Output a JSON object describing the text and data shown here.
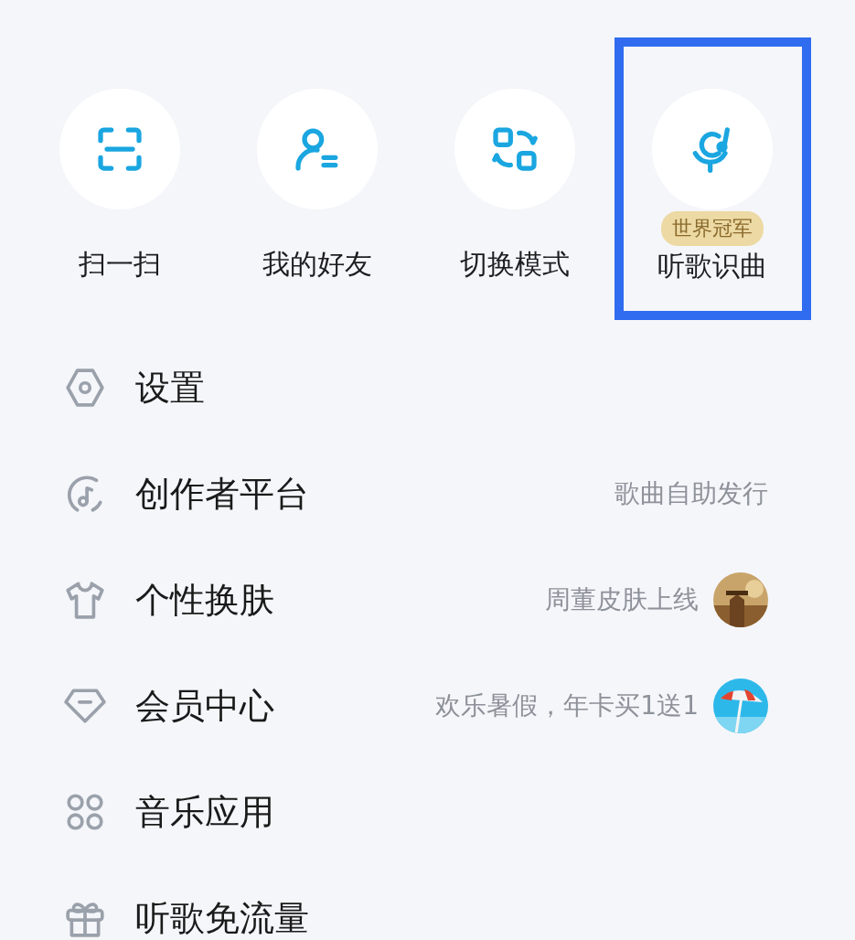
{
  "shortcuts": [
    {
      "label": "扫一扫",
      "highlighted": false
    },
    {
      "label": "我的好友",
      "highlighted": false
    },
    {
      "label": "切换模式",
      "highlighted": false
    },
    {
      "label": "听歌识曲",
      "badge": "世界冠军",
      "highlighted": true
    }
  ],
  "menu": [
    {
      "label": "设置"
    },
    {
      "label": "创作者平台",
      "note": "歌曲自助发行"
    },
    {
      "label": "个性换肤",
      "note": "周董皮肤上线"
    },
    {
      "label": "会员中心",
      "note": "欢乐暑假，年卡买1送1"
    },
    {
      "label": "音乐应用"
    },
    {
      "label": "听歌免流量"
    }
  ]
}
